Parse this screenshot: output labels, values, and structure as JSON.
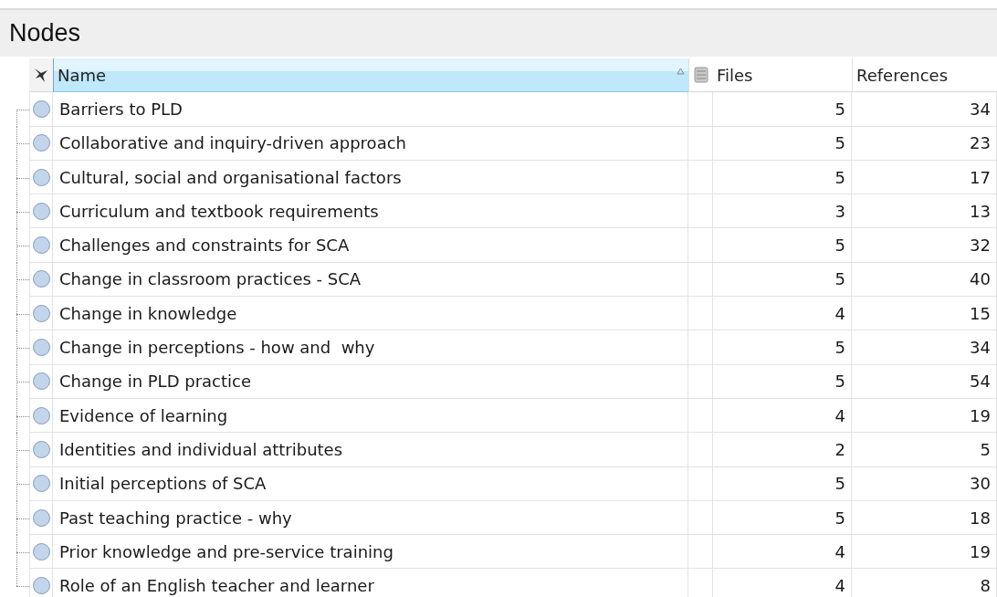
{
  "title": "Nodes",
  "columns": [
    {
      "label": "Name",
      "selected": true
    },
    {
      "label": "Files",
      "selected": false
    },
    {
      "label": "References",
      "selected": false
    }
  ],
  "rows": [
    {
      "name": "Barriers to PLD",
      "files": "5",
      "references": "34"
    },
    {
      "name": "Collaborative and inquiry-driven approach",
      "files": "5",
      "references": "23"
    },
    {
      "name": "Cultural, social and organisational factors",
      "files": "5",
      "references": "17"
    },
    {
      "name": "Curriculum and textbook requirements",
      "files": "3",
      "references": "13"
    },
    {
      "name": "Challenges and constraints for SCA",
      "files": "5",
      "references": "32"
    },
    {
      "name": "Change in classroom practices - SCA",
      "files": "5",
      "references": "40"
    },
    {
      "name": "Change in knowledge",
      "files": "4",
      "references": "15"
    },
    {
      "name": "Change in perceptions - how and  why",
      "files": "5",
      "references": "34"
    },
    {
      "name": "Change in PLD practice",
      "files": "5",
      "references": "54"
    },
    {
      "name": "Evidence of learning",
      "files": "4",
      "references": "19"
    },
    {
      "name": "Identities and individual attributes",
      "files": "2",
      "references": "5"
    },
    {
      "name": "Initial perceptions of SCA",
      "files": "5",
      "references": "30"
    },
    {
      "name": "Past teaching practice - why",
      "files": "5",
      "references": "18"
    },
    {
      "name": "Prior knowledge and pre-service training",
      "files": "4",
      "references": "19"
    },
    {
      "name": "Role of an English teacher and learner",
      "files": "4",
      "references": "8"
    }
  ]
}
